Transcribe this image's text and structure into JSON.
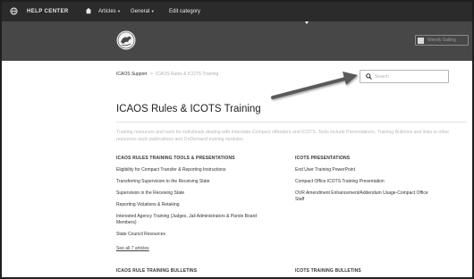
{
  "topbar": {
    "icon": "globe-icon",
    "help_center": "HELP CENTER",
    "home_icon": "home-icon",
    "articles": "Articles",
    "general": "General",
    "edit_category": "Edit category"
  },
  "hero": {
    "logo": "seal-logo",
    "user_name": "Wendy Sailing"
  },
  "breadcrumb": {
    "root": "ICAOS Support",
    "separator": ">",
    "current": "ICAOS Rules & ICOTS Training"
  },
  "search": {
    "placeholder": "Search",
    "icon": "search-icon"
  },
  "page": {
    "title": "ICAOS Rules & ICOTS Training",
    "description": "Training resources and tools for individuals dealing with Interstate Compact offenders and ICOTS. Tools include Presentations, Training Bulletins and links to other resources such publications and OnDemand training modules."
  },
  "sections": {
    "left": {
      "heading": "ICAOS RULES TRAINING TOOLS & PRESENTATIONS",
      "items": [
        "Eligibility for Compact Transfer & Reporting Instructions",
        "Transferring Supervision to the Receiving State",
        "Supervision in the Receiving State",
        "Reporting Violations & Retaking",
        "Interested Agency Training (Judges, Jail Administrators & Parole Board",
        "Members)",
        "State Council Resources"
      ],
      "see_all": "See all 7 articles"
    },
    "right": {
      "heading": "ICOTS PRESENTATIONS",
      "items": [
        "End User Training PowerPoint",
        "Compact Office ICOTS Training Presentation",
        "OVR Amendment Enhancement/Addendum Usage-Compact Office",
        "Staff"
      ]
    },
    "bottom_left": {
      "heading": "ICAOS RULE TRAINING BULLETINS"
    },
    "bottom_right": {
      "heading": "ICOTS TRAINING BULLETINS"
    }
  },
  "colors": {
    "topbar": "#2b2b2b",
    "hero": "#474747",
    "arrow": "#5a5a5a"
  }
}
